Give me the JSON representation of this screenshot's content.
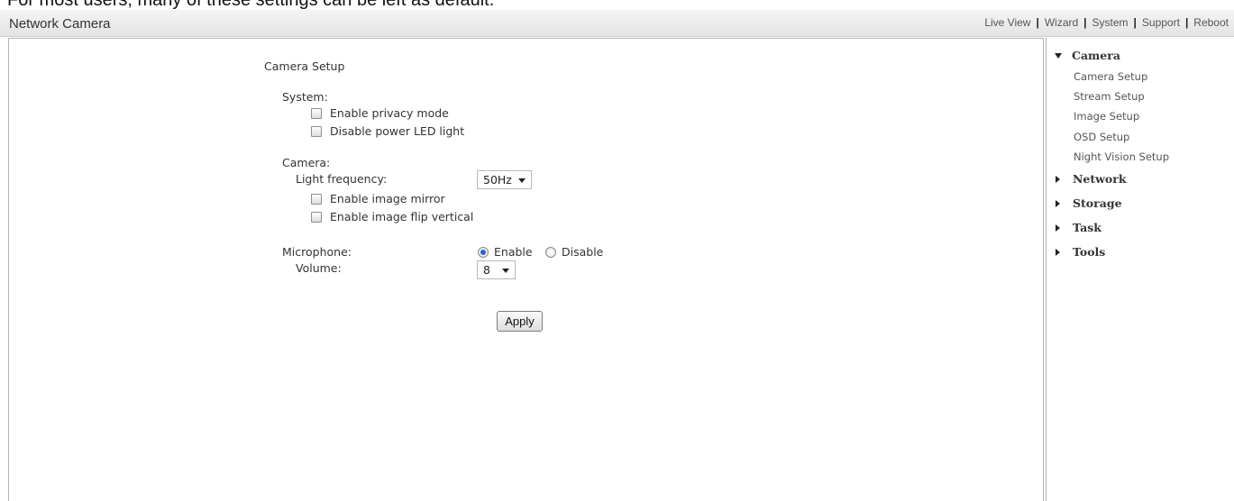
{
  "caption": "For most users, many of these settings can be left as default.",
  "header": {
    "title": "Network Camera",
    "nav": [
      "Live View",
      "Wizard",
      "System",
      "Support",
      "Reboot"
    ]
  },
  "main": {
    "heading": "Camera Setup",
    "system": {
      "label": "System:",
      "privacy_mode": "Enable privacy mode",
      "power_led": "Disable power LED light"
    },
    "camera": {
      "label": "Camera:",
      "light_frequency_label": "Light frequency:",
      "light_frequency_value": "50Hz",
      "image_mirror": "Enable image mirror",
      "image_flip": "Enable image flip vertical"
    },
    "microphone": {
      "label": "Microphone:",
      "enable": "Enable",
      "disable": "Disable",
      "selected": "Enable",
      "volume_label": "Volume:",
      "volume_value": "8"
    },
    "apply_label": "Apply"
  },
  "sidebar": {
    "camera": {
      "label": "Camera",
      "items": [
        "Camera Setup",
        "Stream Setup",
        "Image Setup",
        "OSD Setup",
        "Night Vision Setup"
      ]
    },
    "network": "Network",
    "storage": "Storage",
    "task": "Task",
    "tools": "Tools"
  }
}
